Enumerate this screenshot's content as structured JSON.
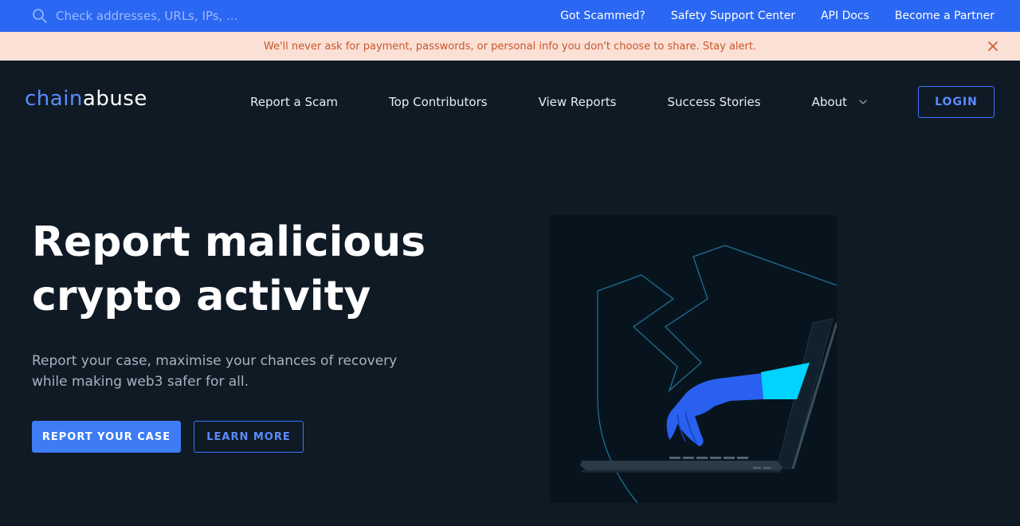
{
  "topbar": {
    "search_placeholder": "Check addresses, URLs, IPs, ...",
    "links": [
      "Got Scammed?",
      "Safety Support Center",
      "API Docs",
      "Become a Partner"
    ]
  },
  "alert": {
    "message": "We'll never ask for payment, passwords, or personal info you don't choose to share. Stay alert."
  },
  "nav": {
    "logo_part1": "chain",
    "logo_part2": "abuse",
    "items": [
      "Report a Scam",
      "Top Contributors",
      "View Reports",
      "Success Stories",
      "About"
    ],
    "login_label": "LOGIN"
  },
  "hero": {
    "title_line1": "Report malicious",
    "title_line2": "crypto activity",
    "subtitle": "Report your case, maximise your chances of recovery while making web3 safer for all.",
    "primary_button": "REPORT YOUR CASE",
    "secondary_button": "LEARN MORE"
  },
  "colors": {
    "topbar_bg": "#2a67f2",
    "alert_bg": "#fbe0d6",
    "alert_text": "#c8572a",
    "page_bg": "#0f1a25",
    "accent": "#3d7cf5",
    "hand": "#2a60f0",
    "cuff": "#00d3ff"
  }
}
